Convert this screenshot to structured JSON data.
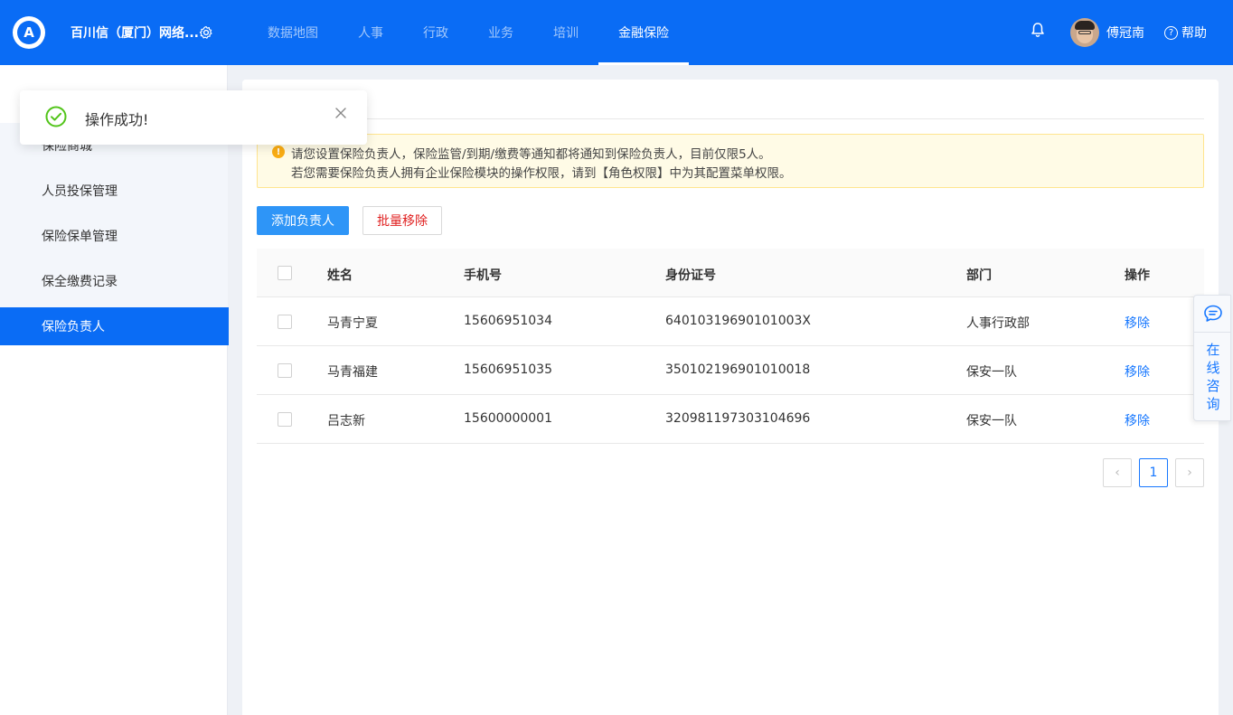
{
  "header": {
    "logo_letter": "A",
    "company": "百川信（厦门）网络...",
    "nav": [
      {
        "label": "数据地图"
      },
      {
        "label": "人事"
      },
      {
        "label": "行政"
      },
      {
        "label": "业务"
      },
      {
        "label": "培训"
      },
      {
        "label": "金融保险"
      }
    ],
    "active_nav": "金融保险",
    "user_name": "傅冠南",
    "help_label": "帮助",
    "help_icon_glyph": "?"
  },
  "sidebar": {
    "items": [
      {
        "label": "保险商城"
      },
      {
        "label": "人员投保管理"
      },
      {
        "label": "保险保单管理"
      },
      {
        "label": "保全缴费记录"
      },
      {
        "label": "保险负责人"
      }
    ],
    "active_item": "保险负责人"
  },
  "toast": {
    "message": "操作成功!"
  },
  "alert": {
    "icon_glyph": "!",
    "line1": "请您设置保险负责人，保险监管/到期/缴费等通知都将通知到保险负责人，目前仅限5人。",
    "line2": "若您需要保险负责人拥有企业保险模块的操作权限，请到【角色权限】中为其配置菜单权限。"
  },
  "toolbar": {
    "add_label": "添加负责人",
    "batch_remove_label": "批量移除"
  },
  "table": {
    "columns": [
      "姓名",
      "手机号",
      "身份证号",
      "部门",
      "操作"
    ],
    "rows": [
      {
        "name": "马青宁夏",
        "phone": "15606951034",
        "id_number": "64010319690101003X",
        "department": "人事行政部",
        "action": "移除"
      },
      {
        "name": "马青福建",
        "phone": "15606951035",
        "id_number": "350102196901010018",
        "department": "保安一队",
        "action": "移除"
      },
      {
        "name": "吕志新",
        "phone": "15600000001",
        "id_number": "320981197303104696",
        "department": "保安一队",
        "action": "移除"
      }
    ]
  },
  "pagination": {
    "current_page": "1",
    "prev_glyph": "‹",
    "next_glyph": "›"
  },
  "consult": {
    "label": "在线咨询"
  },
  "colors": {
    "brand": "#0a6cf5",
    "primary_button": "#2e95f7",
    "link": "#1677ff",
    "danger": "#e02020",
    "success": "#52c41a",
    "warning": "#faad14"
  }
}
